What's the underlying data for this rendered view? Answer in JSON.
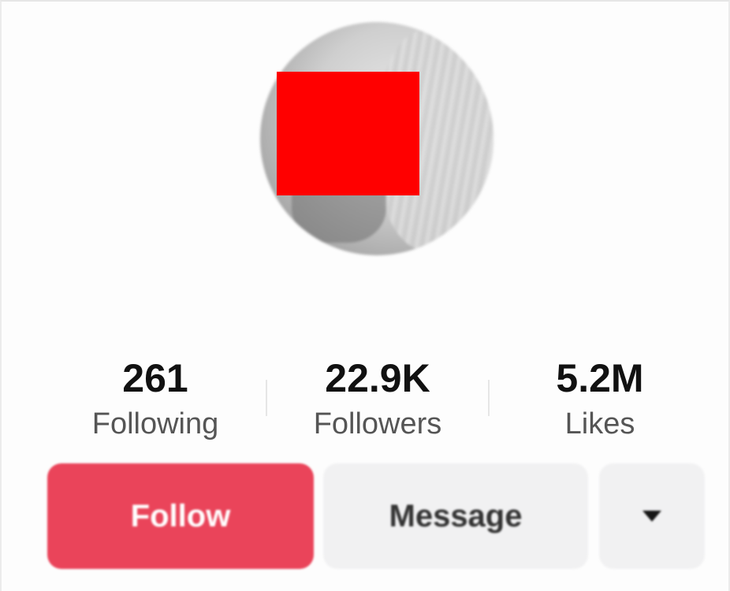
{
  "profile": {
    "avatar": {
      "icon": "profile-photo-redacted"
    }
  },
  "stats": {
    "following": {
      "value": "261",
      "label": "Following"
    },
    "followers": {
      "value": "22.9K",
      "label": "Followers"
    },
    "likes": {
      "value": "5.2M",
      "label": "Likes"
    }
  },
  "actions": {
    "follow_label": "Follow",
    "message_label": "Message",
    "more_icon": "caret-down-icon"
  },
  "colors": {
    "follow_button": "#ea445a",
    "secondary_button": "#f1f1f2",
    "redaction": "#ff0000"
  }
}
